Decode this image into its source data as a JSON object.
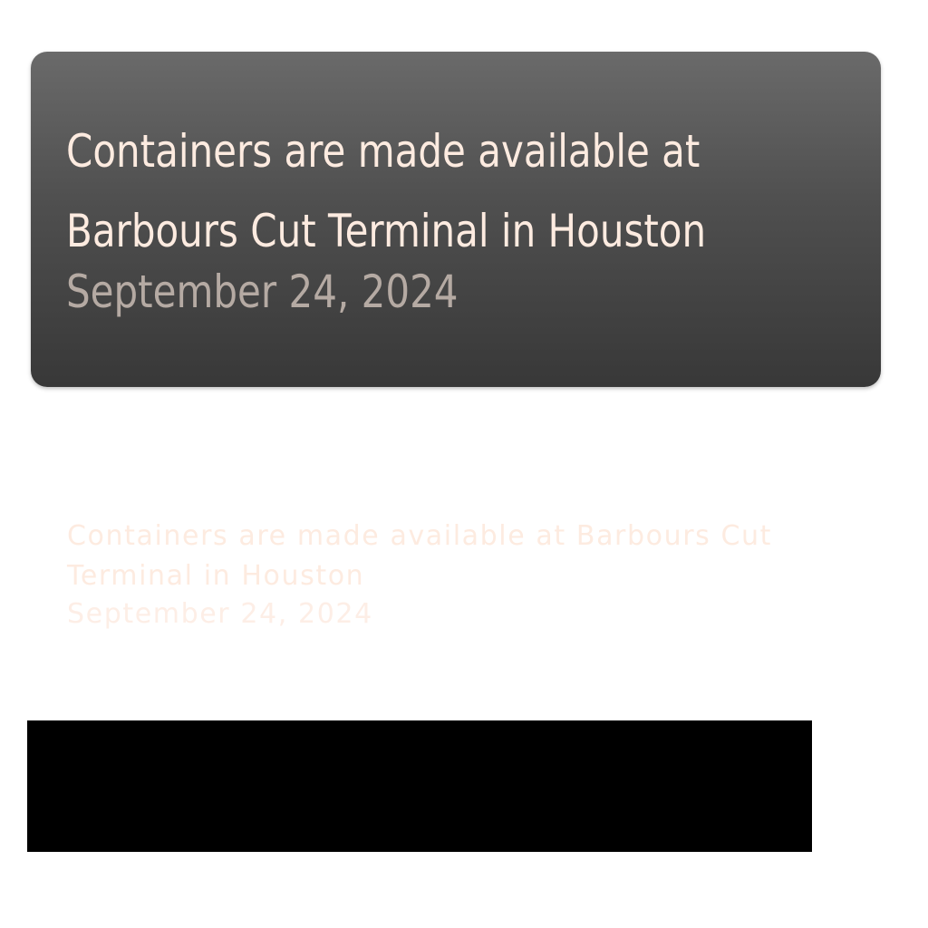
{
  "card": {
    "title": "Containers are made available at Barbours Cut Terminal in Houston",
    "date": "September 24, 2024"
  },
  "ghost": {
    "title": "Containers are made available at Barbours Cut Terminal in Houston",
    "date": "September 24, 2024"
  },
  "colors": {
    "card_title": "#fdebe0",
    "card_date": "#b5aaa3",
    "card_gradient_top": "#6a6a6a",
    "card_gradient_bottom": "#383838",
    "bar": "#000000"
  }
}
